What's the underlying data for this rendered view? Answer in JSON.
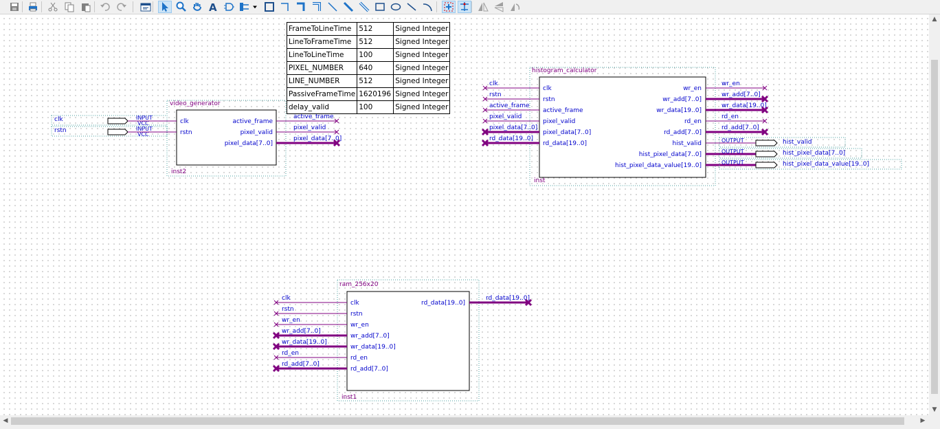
{
  "colors": {
    "wire": "#800080",
    "bus": "#800080",
    "border": "#000000",
    "label": "#0000cc",
    "instname": "#800080",
    "dotted": "#4aa0a0",
    "toolbar_active": "#cce4f7"
  },
  "toolbar": {
    "icons": [
      "save-icon",
      "print-icon",
      "cut-icon",
      "copy-icon",
      "paste-icon",
      "undo-icon",
      "redo-icon",
      "hierarchy-up-icon",
      "select-pointer-icon",
      "zoom-icon",
      "hand-pan-icon",
      "text-tool-icon",
      "symbol-tool-icon",
      "pin-tool-icon",
      "dropdown-arrow-icon",
      "block-tool-icon",
      "orthogonal-node-icon",
      "orthogonal-bus-icon",
      "orthogonal-conduit-icon",
      "diagonal-node-icon",
      "diagonal-bus-icon",
      "diagonal-conduit-icon",
      "rectangle-icon",
      "ellipse-icon",
      "line-icon",
      "arc-icon",
      "partial-line-select-icon",
      "rubberbanding-icon",
      "flip-horizontal-icon",
      "flip-vertical-icon",
      "rotate-icon"
    ]
  },
  "param_table": {
    "rows": [
      [
        "FrameToLineTime",
        "512",
        "Signed Integer"
      ],
      [
        "LineToFrameTime",
        "512",
        "Signed Integer"
      ],
      [
        "LineToLineTime",
        "100",
        "Signed Integer"
      ],
      [
        "PIXEL_NUMBER",
        "640",
        "Signed Integer"
      ],
      [
        "LINE_NUMBER",
        "512",
        "Signed Integer"
      ],
      [
        "PassiveFrameTime",
        "1620196",
        "Signed Integer"
      ],
      [
        "delay_valid",
        "100",
        "Signed Integer"
      ]
    ]
  },
  "schematic": {
    "pins_in": [
      {
        "name": "clk",
        "type": "INPUT",
        "default": "VCC"
      },
      {
        "name": "rstn",
        "type": "INPUT",
        "default": "VCC"
      }
    ],
    "pins_out": [
      {
        "name": "hist_valid",
        "type": "OUTPUT"
      },
      {
        "name": "hist_pixel_data[7..0]",
        "type": "OUTPUT"
      },
      {
        "name": "hist_pixel_data_value[19..0]",
        "type": "OUTPUT"
      }
    ],
    "blocks": [
      {
        "id": "video_generator",
        "name": "video_generator",
        "inst": "inst2",
        "inputs": [
          "clk",
          "rstn"
        ],
        "outputs": [
          "active_frame",
          "pixel_valid",
          "pixel_data[7..0]"
        ],
        "out_nets": [
          "active_frame",
          "pixel_valid",
          "pixel_data[7..0]"
        ]
      },
      {
        "id": "histogram_calculator",
        "name": "histogram_calculator",
        "inst": "inst",
        "inputs": [
          "clk",
          "rstn",
          "active_frame",
          "pixel_valid",
          "pixel_data[7..0]",
          "rd_data[19..0]"
        ],
        "in_nets": [
          "clk",
          "rstn",
          "active_frame",
          "pixel_valid",
          "pixel_data[7..0]",
          "rd_data[19..0]"
        ],
        "outputs": [
          "wr_en",
          "wr_add[7..0]",
          "wr_data[19..0]",
          "rd_en",
          "rd_add[7..0]",
          "hist_valid",
          "hist_pixel_data[7..0]",
          "hist_pixel_data_value[19..0]"
        ],
        "out_nets": [
          "wr_en",
          "wr_add[7..0]",
          "wr_data[19..0]",
          "rd_en",
          "rd_add[7..0]"
        ]
      },
      {
        "id": "ram_256x20",
        "name": "ram_256x20",
        "inst": "inst1",
        "inputs": [
          "clk",
          "rstn",
          "wr_en",
          "wr_add[7..0]",
          "wr_data[19..0]",
          "rd_en",
          "rd_add[7..0]"
        ],
        "in_nets": [
          "clk",
          "rstn",
          "wr_en",
          "wr_add[7..0]",
          "wr_data[19..0]",
          "rd_en",
          "rd_add[7..0]"
        ],
        "outputs": [
          "rd_data[19..0]"
        ],
        "out_nets": [
          "rd_data[19..0]"
        ]
      }
    ]
  }
}
